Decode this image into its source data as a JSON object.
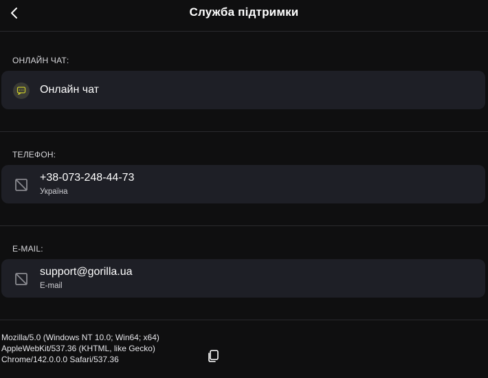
{
  "header": {
    "title": "Служба підтримки",
    "back_icon": "chevron-left-icon"
  },
  "sections": {
    "chat": {
      "label": "ОНЛАЙН ЧАТ:",
      "item_title": "Онлайн чат",
      "icon": "chat-icon",
      "icon_color": "#c8c82a"
    },
    "phone": {
      "label": "ТЕЛЕФОН:",
      "item_title": "+38-073-248-44-73",
      "item_subtitle": "Україна",
      "icon": "no-image-icon"
    },
    "email": {
      "label": "E-MAIL:",
      "item_title": "support@gorilla.ua",
      "item_subtitle": "E-mail",
      "icon": "no-image-icon"
    }
  },
  "footer": {
    "user_agent_lines": [
      "Mozilla/5.0 (Windows NT 10.0; Win64; x64)",
      "AppleWebKit/537.36 (KHTML, like Gecko)",
      "Chrome/142.0.0.0 Safari/537.36"
    ],
    "copy_icon": "copy-icon"
  },
  "colors": {
    "background": "#0f0f10",
    "card": "#1e1f26",
    "divider": "#2a2a2e",
    "accent": "#c8c82a"
  }
}
